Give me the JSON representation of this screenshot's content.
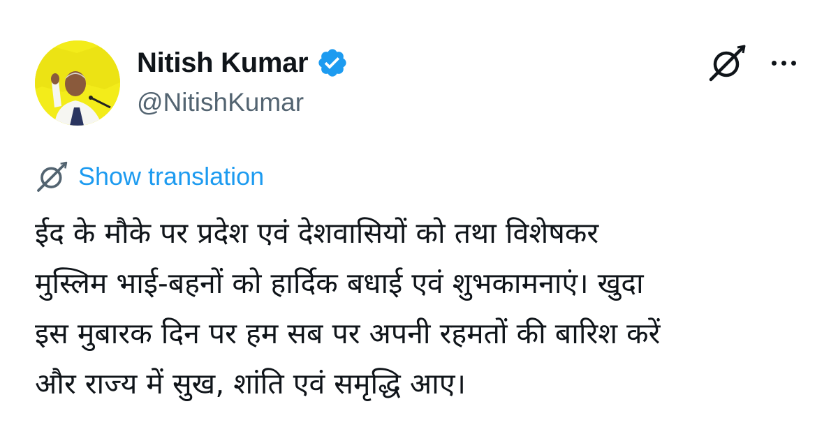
{
  "author": {
    "display_name": "Nitish Kumar",
    "handle": "@NitishKumar",
    "verified_icon": "verified-badge-icon",
    "avatar_bg_color": "#f3ec1a"
  },
  "actions": {
    "grok_icon": "grok-icon",
    "more_icon": "more-horizontal-icon"
  },
  "translation": {
    "icon": "translate-icon",
    "label": "Show translation"
  },
  "tweet": {
    "lines": [
      "ईद के मौके पर प्रदेश एवं देशवासियों को तथा विशेषकर",
      "मुस्लिम भाई-बहनों को हार्दिक बधाई एवं शुभकामनाएं। खुदा",
      "इस मुबारक दिन पर हम सब पर अपनी रहमतों की बारिश करें",
      "और राज्य में सुख, शांति एवं समृद्धि आए।"
    ]
  },
  "colors": {
    "text": "#0f1419",
    "secondary": "#536471",
    "accent": "#1d9bf0"
  }
}
